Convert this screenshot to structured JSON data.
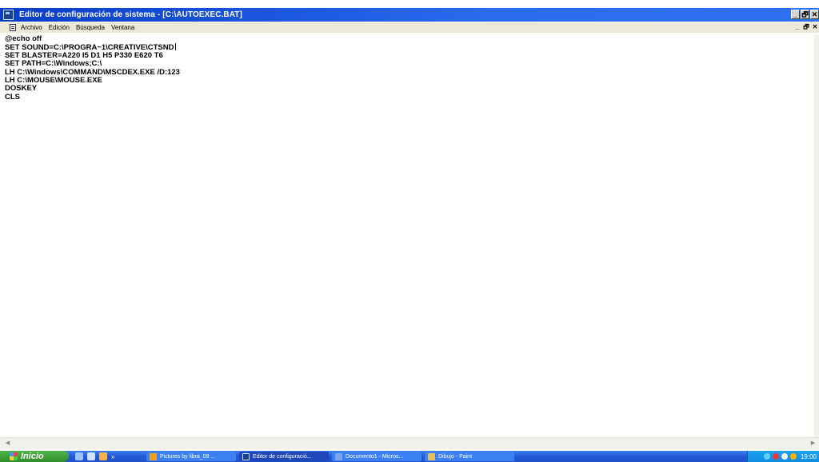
{
  "window": {
    "title": "Editor de configuración de sistema - [C:\\AUTOEXEC.BAT]",
    "buttons": [
      "_",
      "🗗",
      "✕"
    ]
  },
  "menu": {
    "items": [
      "Archivo",
      "Edición",
      "Búsqueda",
      "Ventana"
    ],
    "mdi_buttons": [
      "_",
      "🗗",
      "✕"
    ]
  },
  "editor": {
    "lines": [
      "@echo off",
      "SET SOUND=C:\\PROGRA~1\\CREATIVE\\CTSND",
      "SET BLASTER=A220 I5 D1 H5 P330 E620 T6",
      "SET PATH=C:\\Windows;C:\\",
      "LH C:\\Windows\\COMMAND\\MSCDEX.EXE /D:123",
      "LH C:\\MOUSE\\MOUSE.EXE",
      "DOSKEY",
      "CLS"
    ]
  },
  "taskbar": {
    "start_label": "Inicio",
    "tasks": [
      {
        "label": "Pictures by libra_09 ...",
        "icon": "browser-icon",
        "color": "#f0a020"
      },
      {
        "label": "Editor de configuració...",
        "icon": "sysedit-icon",
        "color": "#1b3f8f"
      },
      {
        "label": "Documento1 - Micros...",
        "icon": "word-icon",
        "color": "#7aa8f0"
      },
      {
        "label": "Dibujo - Paint",
        "icon": "paint-icon",
        "color": "#e0c060"
      }
    ],
    "clock": "19:00"
  }
}
